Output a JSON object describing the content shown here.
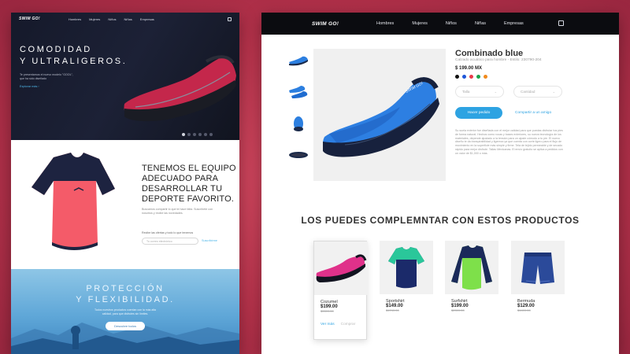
{
  "brand": {
    "logo": "SWIM GO!"
  },
  "nav": {
    "items": [
      "Hombres",
      "Mujeres",
      "Niños",
      "Niñas",
      "Empresas"
    ]
  },
  "landing": {
    "hero": {
      "title": "COMODIDAD\nY ULTRALIGEROS.",
      "description": "Te presentamos el nuevo modelo \"GOOL\", que ha sido diseñado",
      "link": "Explorar más  ›",
      "slide_count": 6,
      "active_slide": 1
    },
    "equipo": {
      "title": "TENEMOS EL EQUIPO\nADECUADO PARA\nDESARROLLAR TU\nDEPORTE FAVORITO.",
      "description": "Buscamos compartir lo que te hace falta. Suscríbete con nosotros y recibe las novedades.",
      "newsletter_label": "Recibe las ofertas y todo lo que tenemos",
      "email_placeholder": "Tu correo electrónico",
      "subscribe": "Suscribirme"
    },
    "proteccion": {
      "title": "PROTECCIÓN\nY FLEXIBILIDAD.",
      "description": "Todos nuestros productos cuentan con la más alta calidad, para que disfrutes sin límites.",
      "button": "Descubre todos"
    }
  },
  "product": {
    "title": "Combinado blue",
    "subtitle": "Calzado acuático para hombre  -  Estilo: 230790-204",
    "price": "$ 199.00 MX",
    "swatches": [
      "#111111",
      "#1e56d8",
      "#e83a4a",
      "#1aa34a",
      "#f08a1c"
    ],
    "size_label": "Talla",
    "qty_label": "Cantidad",
    "order_button": "Hacer pedido",
    "share_link": "Compartir a un amigo",
    "description": "Su suela exterior fue diseñada con el mejor calidad para que puedas disfrutar tus pies de forma natural. Hechos como rocas y bases exteriores, su nueva tecnología de los materiales, depende ajustado a la tensión para un ajuste cómodo a tu pie. El nuevo diseño te da transpirabilidad y ligereza ya que cuenta con corte ligero para el flujo de movimiento en la superficie más simple y firme. Tela de tejido permeable y de secado rápido para mejor disfrute. Tallas Mexicanas. El envío gratuito se aplica a pedidos con un valor de $1,000 o más."
  },
  "recommendations": {
    "title": "LOS PUEDES COMPLEMNTAR CON ESTOS PRODUCTOS",
    "items": [
      {
        "name": "Cozumel",
        "price": "$199.00",
        "old": "$3399.00",
        "more": "Ver más",
        "buy": "Comprar"
      },
      {
        "name": "Sportshirt",
        "price": "$149.00",
        "old": "$1749.00"
      },
      {
        "name": "Surfshirt",
        "price": "$199.00",
        "old": "$2399.00"
      },
      {
        "name": "Bermuda",
        "price": "$129.00",
        "old": "$1499.00"
      }
    ]
  }
}
